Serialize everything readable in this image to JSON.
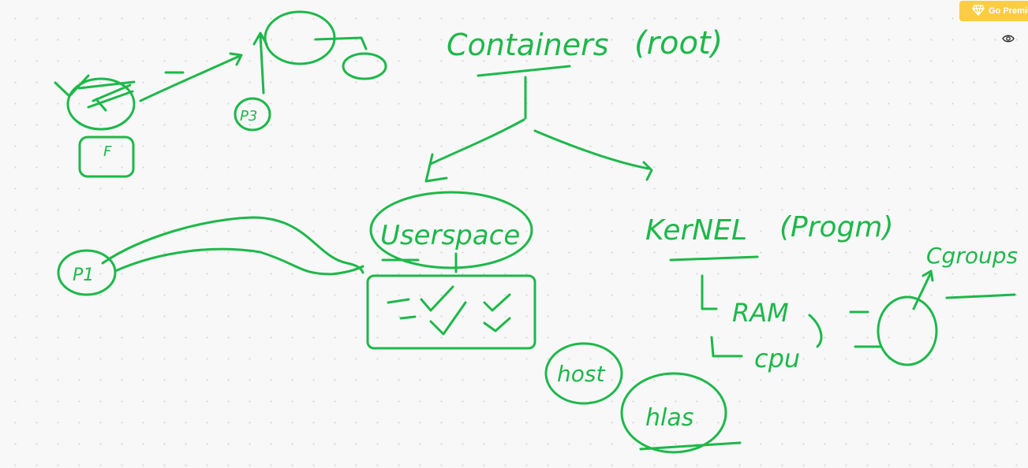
{
  "toolbar": {
    "premium_label": "Go Premium",
    "premium_icon": "diamond-icon",
    "view_icon": "eye-icon",
    "premium_color": "#fccc45"
  },
  "whiteboard": {
    "ink_color": "#1db84a",
    "background_color": "#f8f8f8",
    "handwriting": {
      "containers": "Containers",
      "root": "(root)",
      "userspace": "Userspace",
      "kernel": "KerNEL",
      "program": "(Progm)",
      "ram": "RAM",
      "cpu": "cpu",
      "cgroups": "Cgroups",
      "host": "host",
      "hlas": "hlas",
      "p3": "P3",
      "f_label": "F",
      "p1": "P1"
    }
  }
}
